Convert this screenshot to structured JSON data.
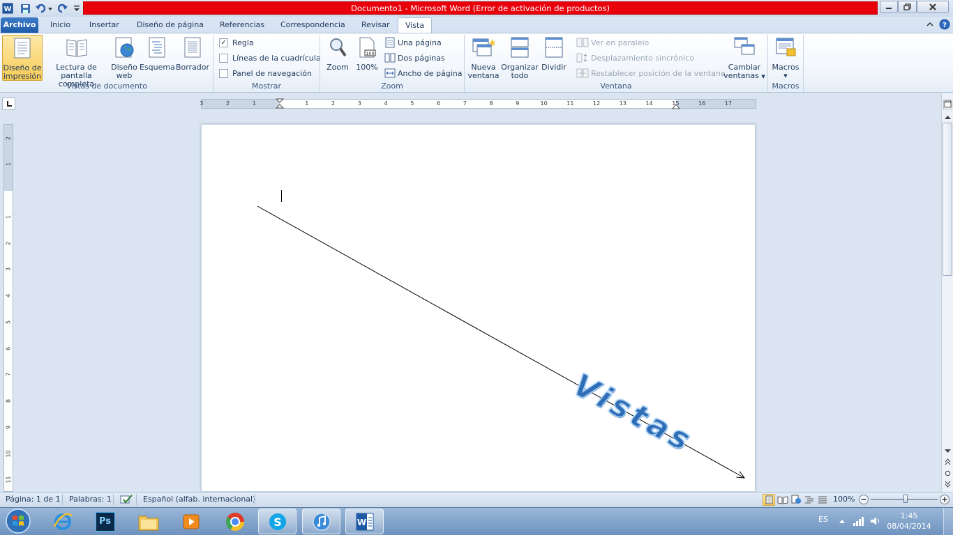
{
  "window": {
    "title": "Documento1  -  Microsoft Word (Error de activación de productos)"
  },
  "tabs": [
    "Archivo",
    "Inicio",
    "Insertar",
    "Diseño de página",
    "Referencias",
    "Correspondencia",
    "Revisar",
    "Vista"
  ],
  "ribbon": {
    "vistas": {
      "impresion": [
        "Diseño de",
        "impresión"
      ],
      "lectura": [
        "Lectura de",
        "pantalla completa"
      ],
      "web": [
        "Diseño",
        "web"
      ],
      "esquema": "Esquema",
      "borrador": "Borrador",
      "label": "Vistas de documento"
    },
    "mostrar": {
      "regla": "Regla",
      "lineas": "Líneas de la cuadrícula",
      "panel": "Panel de navegación",
      "label": "Mostrar"
    },
    "zoom": {
      "zoom": "Zoom",
      "cien": "100%",
      "una": "Una página",
      "dos": "Dos páginas",
      "ancho": "Ancho de página",
      "label": "Zoom"
    },
    "ventana": {
      "nueva": [
        "Nueva",
        "ventana"
      ],
      "organizar": [
        "Organizar",
        "todo"
      ],
      "dividir": "Dividir",
      "paralelo": "Ver en paralelo",
      "sincronico": "Desplazamiento sincrónico",
      "restablecer": "Restablecer posición de la ventana",
      "cambiar": [
        "Cambiar",
        "ventanas"
      ],
      "label": "Ventana"
    },
    "macros": {
      "macros": "Macros",
      "label": "Macros"
    }
  },
  "document": {
    "wordart": "Vistas"
  },
  "ruler": {
    "h_ticks": [
      "3",
      "2",
      "1",
      "1",
      "2",
      "3",
      "4",
      "5",
      "6",
      "7",
      "8",
      "9",
      "10",
      "11",
      "12",
      "13",
      "14",
      "15",
      "16",
      "17"
    ],
    "v_ticks": [
      "2",
      "1",
      "1",
      "2",
      "3",
      "4",
      "5",
      "6",
      "7",
      "8",
      "9",
      "10",
      "11"
    ]
  },
  "status": {
    "pagina": "Página: 1 de 1",
    "palabras": "Palabras: 1",
    "idioma": "Español (alfab. internacional)",
    "zoom": "100%"
  },
  "taskbar": {
    "ps": "Ps",
    "lang": "ES",
    "time": "1:45",
    "date": "08/04/2014"
  },
  "colors": {
    "title_error": "#e8000b",
    "accent": "#1d5aa8",
    "wordart": "#2f6db6"
  }
}
